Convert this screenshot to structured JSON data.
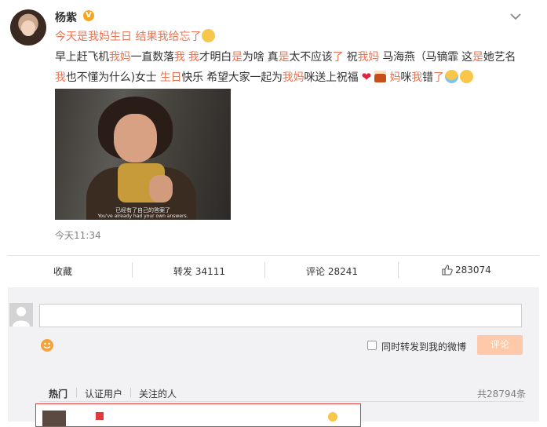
{
  "post": {
    "username": "杨紫",
    "verified_badge": "V",
    "headline": "今天是我妈生日 结果我给忘了",
    "line1": [
      {
        "t": "早上赶飞机",
        "h": false
      },
      {
        "t": "我妈",
        "h": true
      },
      {
        "t": "一直数落",
        "h": false
      },
      {
        "t": "我",
        "h": true
      },
      {
        "t": " ",
        "h": false
      },
      {
        "t": "我",
        "h": true
      },
      {
        "t": "才明白",
        "h": false
      },
      {
        "t": "是",
        "h": true
      },
      {
        "t": "为啥 真",
        "h": false
      },
      {
        "t": "是",
        "h": true
      },
      {
        "t": "太不应该",
        "h": false
      },
      {
        "t": "了",
        "h": true
      },
      {
        "t": " 祝",
        "h": false
      },
      {
        "t": "我妈",
        "h": true
      },
      {
        "t": " 马海燕（马镝霏 这",
        "h": false
      },
      {
        "t": "是",
        "h": true
      },
      {
        "t": "她艺名",
        "h": false
      }
    ],
    "line2a": [
      {
        "t": "我",
        "h": true
      },
      {
        "t": "也不懂为什么)女士 ",
        "h": false
      },
      {
        "t": "生日",
        "h": true
      },
      {
        "t": "快乐 希望大家一起为",
        "h": false
      },
      {
        "t": "我妈",
        "h": true
      },
      {
        "t": "咪送上祝福 ",
        "h": false
      }
    ],
    "line2b": [
      {
        "t": "妈",
        "h": true
      },
      {
        "t": "咪",
        "h": false
      },
      {
        "t": "我",
        "h": true
      },
      {
        "t": "错",
        "h": false
      },
      {
        "t": "了",
        "h": true
      }
    ],
    "image_subtitle_cn": "已经有了自己的答案了",
    "image_subtitle_en": "You've already had your own answers.",
    "timestamp": "今天11:34",
    "icons": [
      "verified-badge-icon",
      "chevron-down-icon",
      "laugh-emoji-icon",
      "heart-emoji-icon",
      "cake-emoji-icon",
      "crying-emoji-icon"
    ]
  },
  "actions": {
    "favorite": "收藏",
    "repost": "转发 34111",
    "comment": "评论 28241",
    "like": "283074"
  },
  "composer": {
    "sync_label": "同时转发到我的微博",
    "submit": "评论"
  },
  "filters": {
    "hot": "热门",
    "verified": "认证用户",
    "following": "关注的人",
    "total": "共28794条"
  },
  "colors": {
    "highlight": "#eb7350",
    "submit_button": "#fdc9a8",
    "panel_bg": "#f2f2f5"
  }
}
